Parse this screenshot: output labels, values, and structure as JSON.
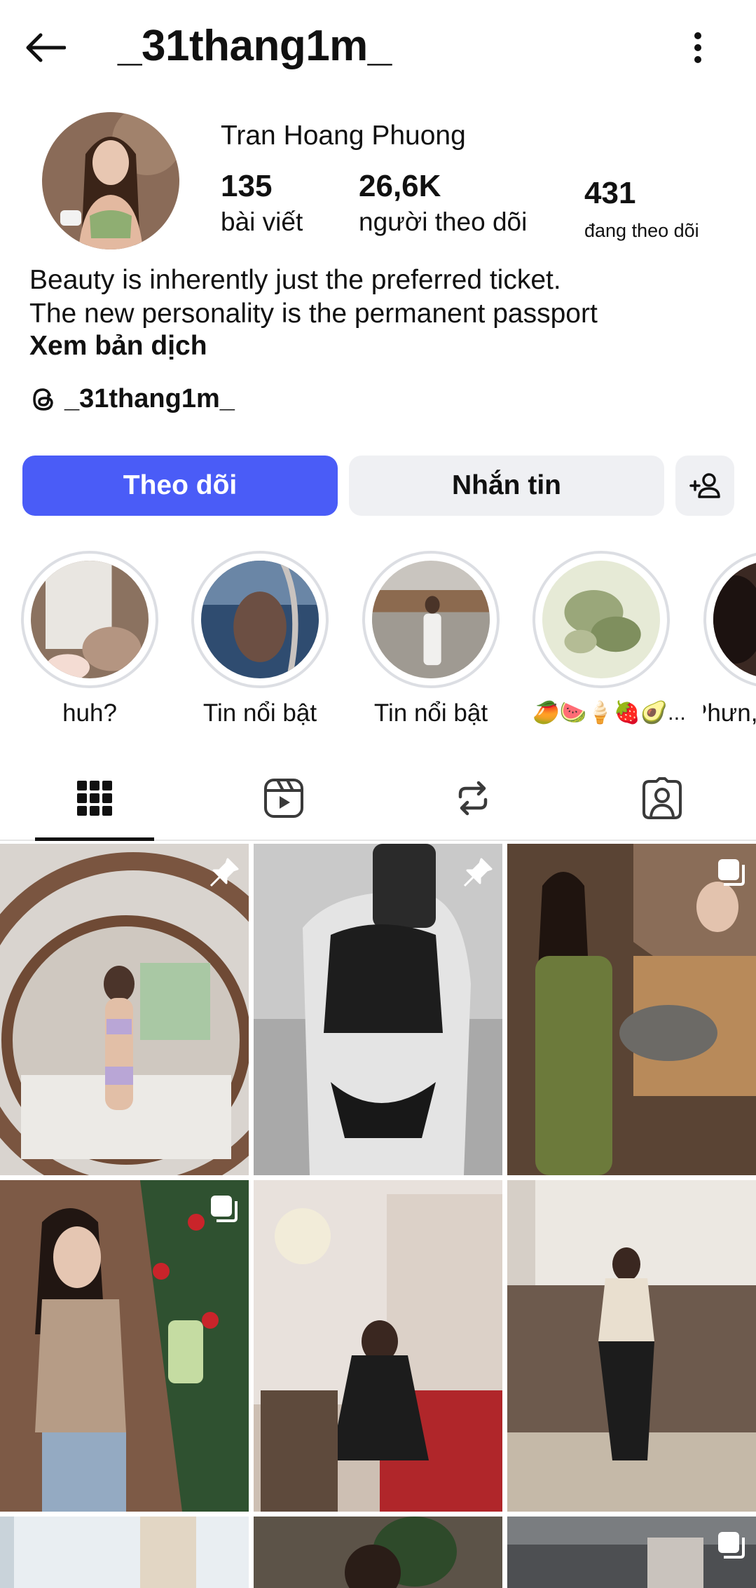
{
  "header": {
    "username": "_31thang1m_",
    "back_icon": "arrow-left-icon",
    "more_icon": "more-vertical-icon"
  },
  "profile": {
    "display_name": "Tran Hoang Phuong",
    "stats": [
      {
        "value": "135",
        "label": "bài viết"
      },
      {
        "value": "26,6K",
        "label": "người theo dõi"
      },
      {
        "value": "431",
        "label": "đang theo dõi"
      }
    ],
    "bio_line1": "Beauty is inherently just the preferred ticket.",
    "bio_line2": "The new personality is the permanent passport",
    "translate_label": "Xem bản dịch",
    "threads_handle": "_31thang1m_"
  },
  "actions": {
    "follow_label": "Theo dõi",
    "message_label": "Nhắn tin",
    "add_person_icon": "add-person-icon"
  },
  "highlights": [
    {
      "label": "huh?"
    },
    {
      "label": "Tin nổi bật"
    },
    {
      "label": "Tin nổi bật"
    },
    {
      "label": "🥭🍉🍦🍓🥑..."
    },
    {
      "label": "Phưn,"
    }
  ],
  "tabs": [
    {
      "name": "grid",
      "icon": "grid-icon",
      "active": true
    },
    {
      "name": "reels",
      "icon": "reels-icon",
      "active": false
    },
    {
      "name": "reposts",
      "icon": "repost-icon",
      "active": false
    },
    {
      "name": "tagged",
      "icon": "tagged-icon",
      "active": false
    }
  ],
  "colors": {
    "accent": "#4a5cf7",
    "button_secondary": "#eff0f3",
    "text": "#111111"
  },
  "posts": [
    {
      "badge": "pin-icon"
    },
    {
      "badge": "pin-icon"
    },
    {
      "badge": "carousel-icon"
    },
    {
      "badge": "carousel-icon"
    },
    {
      "badge": ""
    },
    {
      "badge": ""
    },
    {
      "badge": ""
    },
    {
      "badge": ""
    },
    {
      "badge": "carousel-icon"
    }
  ]
}
